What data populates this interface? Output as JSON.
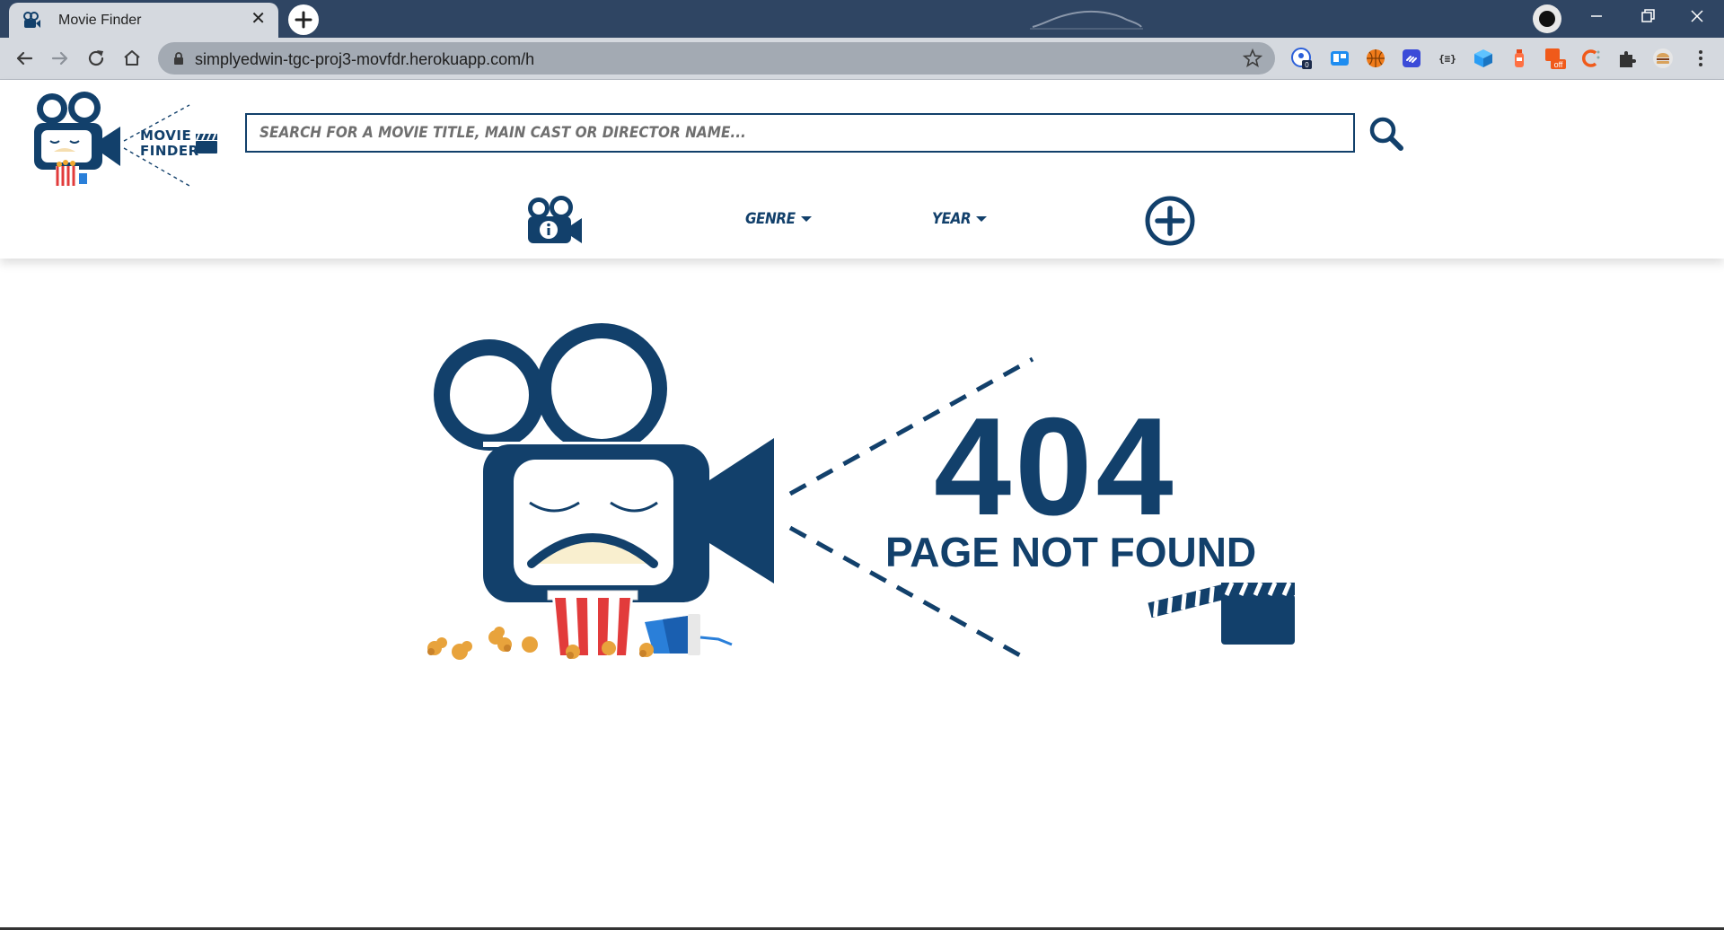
{
  "browser": {
    "tab_title": "Movie Finder",
    "tab_close_glyph": "✕",
    "url": "simplyedwin-tgc-proj3-movfdr.herokuapp.com/h",
    "extensions": [
      {
        "name": "password-manager-extension",
        "badge": "0",
        "color": "#2b5fd9"
      },
      {
        "name": "trello-extension",
        "color": "#1d8cf0"
      },
      {
        "name": "basketball-extension",
        "color": "#f07b1a"
      },
      {
        "name": "link-extension",
        "color": "#3b4bd8"
      },
      {
        "name": "json-extension",
        "color": "#222222",
        "text": "{≡}"
      },
      {
        "name": "box-extension",
        "color": "#2a9df4"
      },
      {
        "name": "bottle-extension",
        "color": "#e64a19"
      },
      {
        "name": "off-extension",
        "color": "#f05a1a",
        "badge": "off"
      },
      {
        "name": "c-extension",
        "color": "#f05a1a"
      },
      {
        "name": "puzzle-extension",
        "color": "#333333"
      },
      {
        "name": "burger-extension",
        "color": "#c8a15a"
      }
    ]
  },
  "site": {
    "logo_line1": "MOVIE",
    "logo_line2": "FINDER",
    "search_placeholder": "SEARCH FOR A MOVIE TITLE, MAIN CAST OR DIRECTOR NAME...",
    "nav": {
      "genre_label": "GENRE",
      "year_label": "YEAR"
    },
    "brand_color": "#12406b"
  },
  "error": {
    "code": "404",
    "message": "PAGE NOT FOUND"
  }
}
